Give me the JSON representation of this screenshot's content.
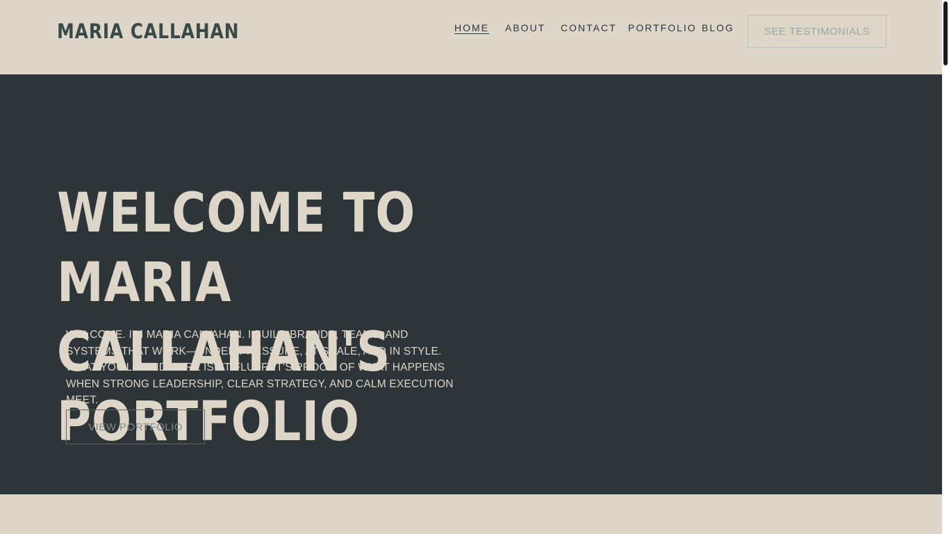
{
  "header": {
    "logo": "MARIA CALLAHAN",
    "nav": [
      {
        "label": "HOME",
        "active": true
      },
      {
        "label": "ABOUT",
        "active": false
      },
      {
        "label": "CONTACT",
        "active": false
      },
      {
        "label": "PORTFOLIO",
        "active": false
      },
      {
        "label": "BLOG",
        "active": false
      }
    ],
    "cta_label": "SEE TESTIMONIALS"
  },
  "hero": {
    "title": "WELCOME TO MARIA CALLAHAN'S PORTFOLIO",
    "intro": "Welcome. I'm Maria Callahan. I build brands, teams, and systems that work—under pressure, at scale, and in style. What you'll find here isn't fluff. It's proof. of what happens when strong leadership, clear strategy, and calm execution meet.",
    "button_label": "VIEW PORTFOLIO"
  },
  "colors": {
    "background": "#ddd6c9",
    "hero_background": "#2d3538",
    "logo": "#3a4a47"
  }
}
